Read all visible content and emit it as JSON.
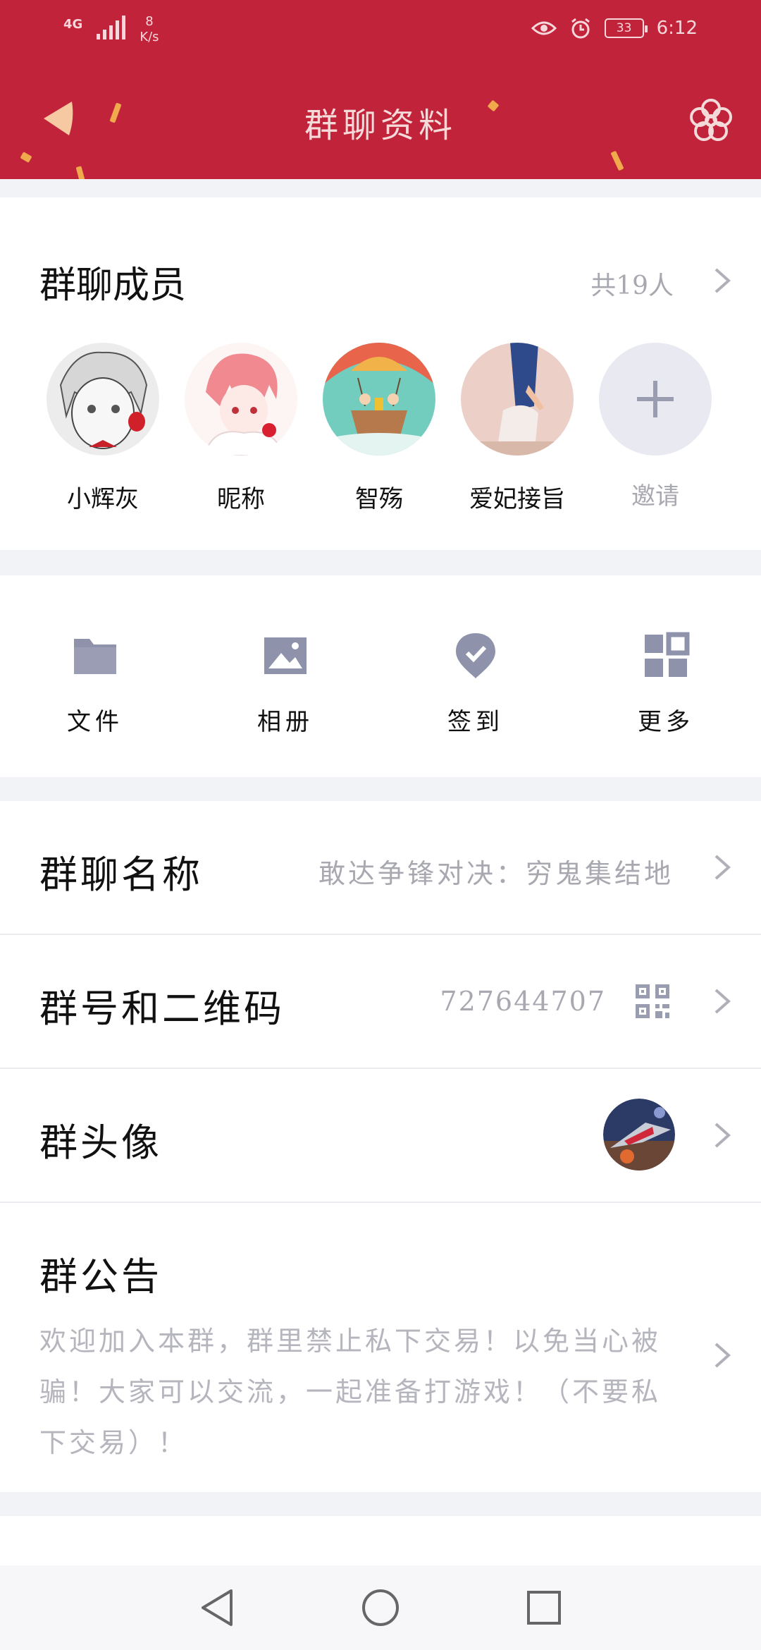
{
  "status_bar": {
    "network": "4G",
    "speed_value": "8",
    "speed_unit": "K/s",
    "battery": "33",
    "time": "6:12"
  },
  "header": {
    "title": "群聊资料"
  },
  "members": {
    "title": "群聊成员",
    "count": "共19人",
    "list": [
      {
        "name": "小辉灰"
      },
      {
        "name": "昵称"
      },
      {
        "name": "智殇"
      },
      {
        "name": "爱妃接旨"
      }
    ],
    "invite_label": "邀请"
  },
  "tools": {
    "items": [
      {
        "label": "文件",
        "icon": "folder-icon"
      },
      {
        "label": "相册",
        "icon": "image-icon"
      },
      {
        "label": "签到",
        "icon": "check-in-icon"
      },
      {
        "label": "更多",
        "icon": "grid-more-icon"
      }
    ]
  },
  "settings": {
    "group_name_label": "群聊名称",
    "group_name_value": "敢达争锋对决：穷鬼集结地",
    "group_id_label": "群号和二维码",
    "group_id_value": "727644707",
    "avatar_label": "群头像",
    "notice_label": "群公告",
    "notice_text": "欢迎加入本群，群里禁止私下交易！以免当心被骗！大家可以交流，一起准备打游戏！（不要私下交易）！"
  },
  "colors": {
    "brand_red": "#c1243a",
    "muted_text": "#a8a8b0",
    "icon_gray": "#8e92ab"
  }
}
